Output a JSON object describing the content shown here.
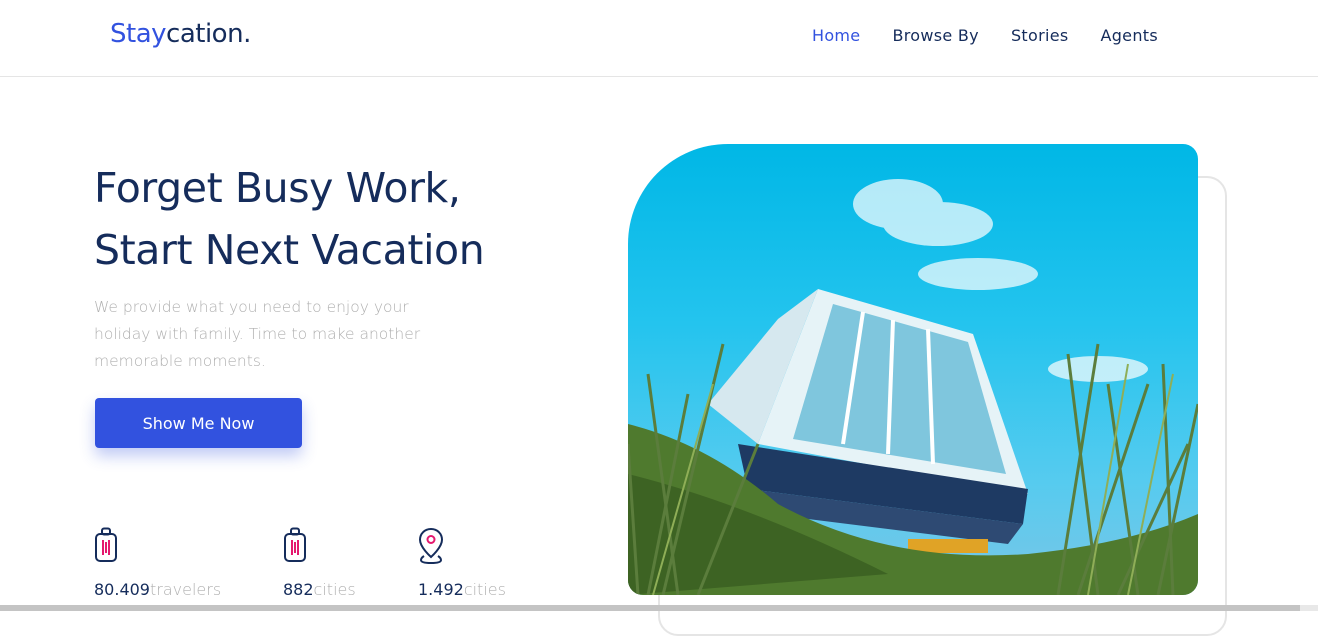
{
  "brand": {
    "accent": "Stay",
    "rest": "cation."
  },
  "nav": {
    "items": [
      {
        "label": "Home"
      },
      {
        "label": "Browse By"
      },
      {
        "label": "Stories"
      },
      {
        "label": "Agents"
      }
    ],
    "active": "Home"
  },
  "hero": {
    "title_line1": "Forget Busy Work,",
    "title_line2": "Start Next Vacation",
    "description": "We provide what you need to enjoy your holiday with family. Time to make another memorable moments.",
    "cta_label": "Show Me Now"
  },
  "stats": [
    {
      "icon": "luggage-icon",
      "number": "80.409",
      "unit": "travelers"
    },
    {
      "icon": "suitcase-icon",
      "number": "882",
      "unit": "cities"
    },
    {
      "icon": "location-pin-icon",
      "number": "1.492",
      "unit": "cities"
    }
  ],
  "colors": {
    "primary": "#3252df",
    "navy": "#152c5b",
    "muted": "#b0b0b0",
    "accent_pink": "#e5186e",
    "sky": "#00b7e6"
  }
}
